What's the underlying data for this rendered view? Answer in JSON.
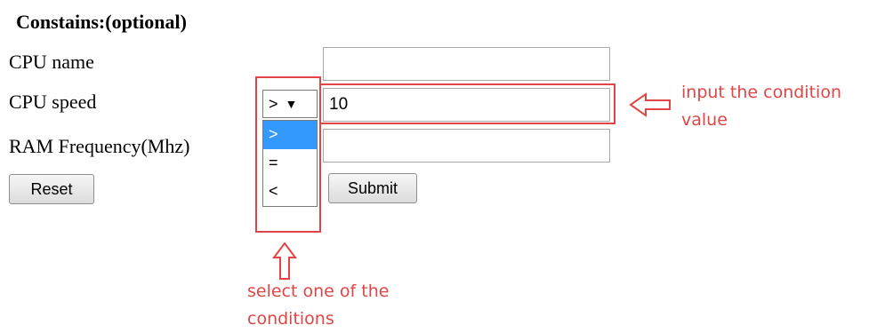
{
  "form": {
    "heading": "Constains:(optional)",
    "cpu_name_label": "CPU name",
    "cpu_name_value": "",
    "cpu_speed_label": "CPU speed",
    "cpu_speed_operator": ">",
    "cpu_speed_value": "10",
    "ram_label": "RAM Frequency(Mhz)",
    "ram_value": "",
    "reset_label": "Reset",
    "submit_label": "Submit"
  },
  "dropdown": {
    "arrow": "▼",
    "options": [
      {
        "label": ">",
        "selected": true
      },
      {
        "label": "=",
        "selected": false
      },
      {
        "label": "<",
        "selected": false
      }
    ]
  },
  "annotations": {
    "input_note_line1": "input the condition",
    "input_note_line2": "value",
    "select_note_line1": "select one of the",
    "select_note_line2": "conditions",
    "color": "#e24545"
  },
  "colors": {
    "highlight": "#3399ff",
    "annotation": "#e24545"
  }
}
